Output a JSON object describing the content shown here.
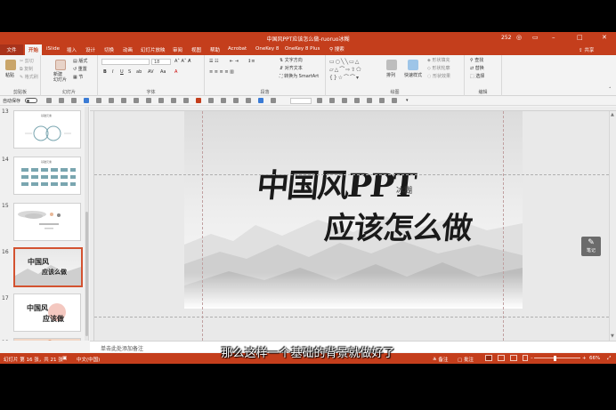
{
  "window": {
    "title": "中国风PPT应该怎么做-ruoruo冰糊",
    "user": "252",
    "share": "共享"
  },
  "tabs": [
    {
      "label": "文件"
    },
    {
      "label": "开始",
      "active": true
    },
    {
      "label": "iSlide"
    },
    {
      "label": "插入"
    },
    {
      "label": "设计"
    },
    {
      "label": "切换"
    },
    {
      "label": "动画"
    },
    {
      "label": "幻灯片放映"
    },
    {
      "label": "审阅"
    },
    {
      "label": "视图"
    },
    {
      "label": "帮助"
    },
    {
      "label": "Acrobat"
    },
    {
      "label": "OneKey 8"
    },
    {
      "label": "OneKey 8 Plus"
    }
  ],
  "search": {
    "label": "搜索"
  },
  "ribbon": {
    "clipboard": {
      "label": "剪贴板",
      "paste": "粘贴",
      "cut": "剪切",
      "copy": "复制",
      "format": "格式刷"
    },
    "slides": {
      "label": "幻灯片",
      "new": "新建\n幻灯片",
      "layout": "版式",
      "reset": "重置",
      "section": "节"
    },
    "font": {
      "label": "字体",
      "size": "18"
    },
    "paragraph": {
      "label": "段落",
      "direction": "文字方向",
      "align": "对齐文本",
      "smartart": "转换为 SmartArt"
    },
    "drawing": {
      "label": "绘图",
      "arrange": "排列",
      "styles": "快速样式",
      "fill": "形状填充",
      "outline": "形状轮廓",
      "effects": "形状效果"
    },
    "editing": {
      "label": "编辑",
      "find": "查找",
      "replace": "替换",
      "select": "选择"
    }
  },
  "qat": {
    "autosave": "自动保存"
  },
  "slides_panel": {
    "thumbnails": [
      {
        "num": "13",
        "caption": "基础元素"
      },
      {
        "num": "14",
        "caption": "基础元素"
      },
      {
        "num": "15",
        "caption": ""
      },
      {
        "num": "16",
        "selected": true
      },
      {
        "num": "17"
      },
      {
        "num": "18"
      }
    ]
  },
  "slide": {
    "title_line1": "中国风PPT",
    "title_line2": "应该怎么做",
    "author": "冰糊"
  },
  "note_button": {
    "label": "笔记"
  },
  "notes": {
    "placeholder": "单击此处添加备注"
  },
  "status": {
    "slide_info": "幻灯片 第 16 张，共 21 张",
    "language": "中文(中国)",
    "notes_btn": "备注",
    "comments_btn": "批注",
    "zoom": "66%"
  },
  "subtitle": "那么这样一个基础的背景就做好了",
  "colors": {
    "accent": "#c43e1c",
    "selection": "#d35230"
  }
}
